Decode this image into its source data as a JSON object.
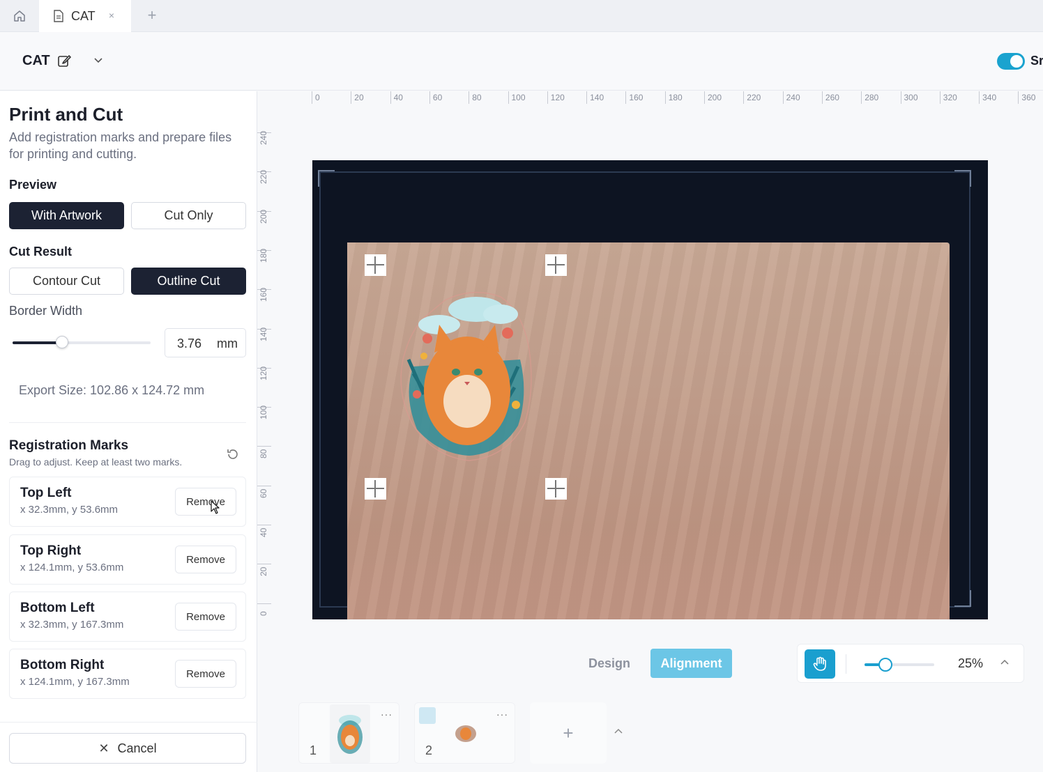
{
  "tabs": {
    "home_icon": "home-icon",
    "active_tab_label": "CAT",
    "close_symbol": "×",
    "add_symbol": "+"
  },
  "header": {
    "project_title": "CAT",
    "toggle_label": "Sr",
    "toggle_on": true,
    "accent_color": "#1aa3cf"
  },
  "panel": {
    "title": "Print and Cut",
    "description": "Add registration marks and prepare files for printing and cutting.",
    "preview": {
      "label": "Preview",
      "options": [
        "With Artwork",
        "Cut Only"
      ],
      "selected": "With Artwork"
    },
    "cut_result": {
      "label": "Cut Result",
      "options": [
        "Contour Cut",
        "Outline Cut"
      ],
      "selected": "Outline Cut"
    },
    "border_width": {
      "label": "Border Width",
      "value": "3.76",
      "unit": "mm",
      "slider_fraction": 0.36
    },
    "export_size": "Export Size: 102.86 x 124.72 mm",
    "registration": {
      "title": "Registration Marks",
      "subtitle": "Drag to adjust. Keep at least two marks.",
      "marks": [
        {
          "name": "Top Left",
          "coords": "x 32.3mm, y 53.6mm",
          "remove_label": "Remove"
        },
        {
          "name": "Top Right",
          "coords": "x 124.1mm, y 53.6mm",
          "remove_label": "Remove"
        },
        {
          "name": "Bottom Left",
          "coords": "x 32.3mm, y 167.3mm",
          "remove_label": "Remove"
        },
        {
          "name": "Bottom Right",
          "coords": "x 124.1mm, y 167.3mm",
          "remove_label": "Remove"
        }
      ]
    },
    "cancel_label": "Cancel"
  },
  "ruler": {
    "horizontal": [
      "0",
      "20",
      "40",
      "60",
      "80",
      "100",
      "120",
      "140",
      "160",
      "180",
      "200",
      "220",
      "240",
      "260",
      "280",
      "300",
      "320",
      "340",
      "360"
    ],
    "vertical": [
      "240",
      "220",
      "200",
      "180",
      "160",
      "140",
      "120",
      "100",
      "80",
      "60",
      "40",
      "20",
      "0"
    ]
  },
  "modes": {
    "design_label": "Design",
    "alignment_label": "Alignment",
    "active": "Alignment"
  },
  "zoom": {
    "value": "25%",
    "slider_fraction": 0.3
  },
  "pages": [
    {
      "number": "1",
      "more": "···"
    },
    {
      "number": "2",
      "more": "···"
    }
  ],
  "pages_add": "+"
}
